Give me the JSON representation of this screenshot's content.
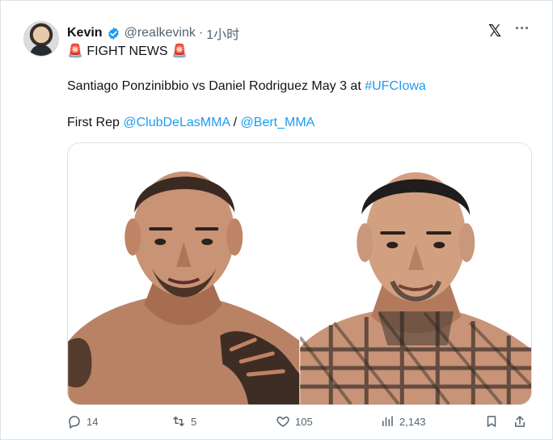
{
  "tweet": {
    "author": {
      "name": "Kevin",
      "handle": "@realkevink",
      "separator": "·",
      "time": "1小时",
      "verified": true
    },
    "headline_prefix_icon": "siren-emoji",
    "headline": "FIGHT NEWS",
    "headline_suffix_icon": "siren-emoji",
    "matchup_text": "Santiago Ponzinibbio vs Daniel Rodriguez May 3 at ",
    "hashtag": "#UFCIowa",
    "rep_prefix": "First Rep ",
    "mention_1": "@ClubDeLasMMA",
    "mention_separator": " / ",
    "mention_2": "@Bert_MMA",
    "media": [
      {
        "alt": "Santiago Ponzinibbio portrait"
      },
      {
        "alt": "Daniel Rodriguez portrait"
      }
    ],
    "actions": {
      "replies": "14",
      "reposts": "5",
      "likes": "105",
      "views": "2,143"
    }
  },
  "icons": {
    "logo": "x-logo-icon",
    "more": "more-dots-icon",
    "reply": "reply-icon",
    "repost": "repost-icon",
    "like": "heart-icon",
    "views": "views-icon",
    "bookmark": "bookmark-icon",
    "share": "share-icon"
  },
  "colors": {
    "link": "#1d9bf0",
    "text": "#0f1419",
    "muted": "#536471",
    "verified": "#1d9bf0",
    "alert": "#e0245e"
  }
}
